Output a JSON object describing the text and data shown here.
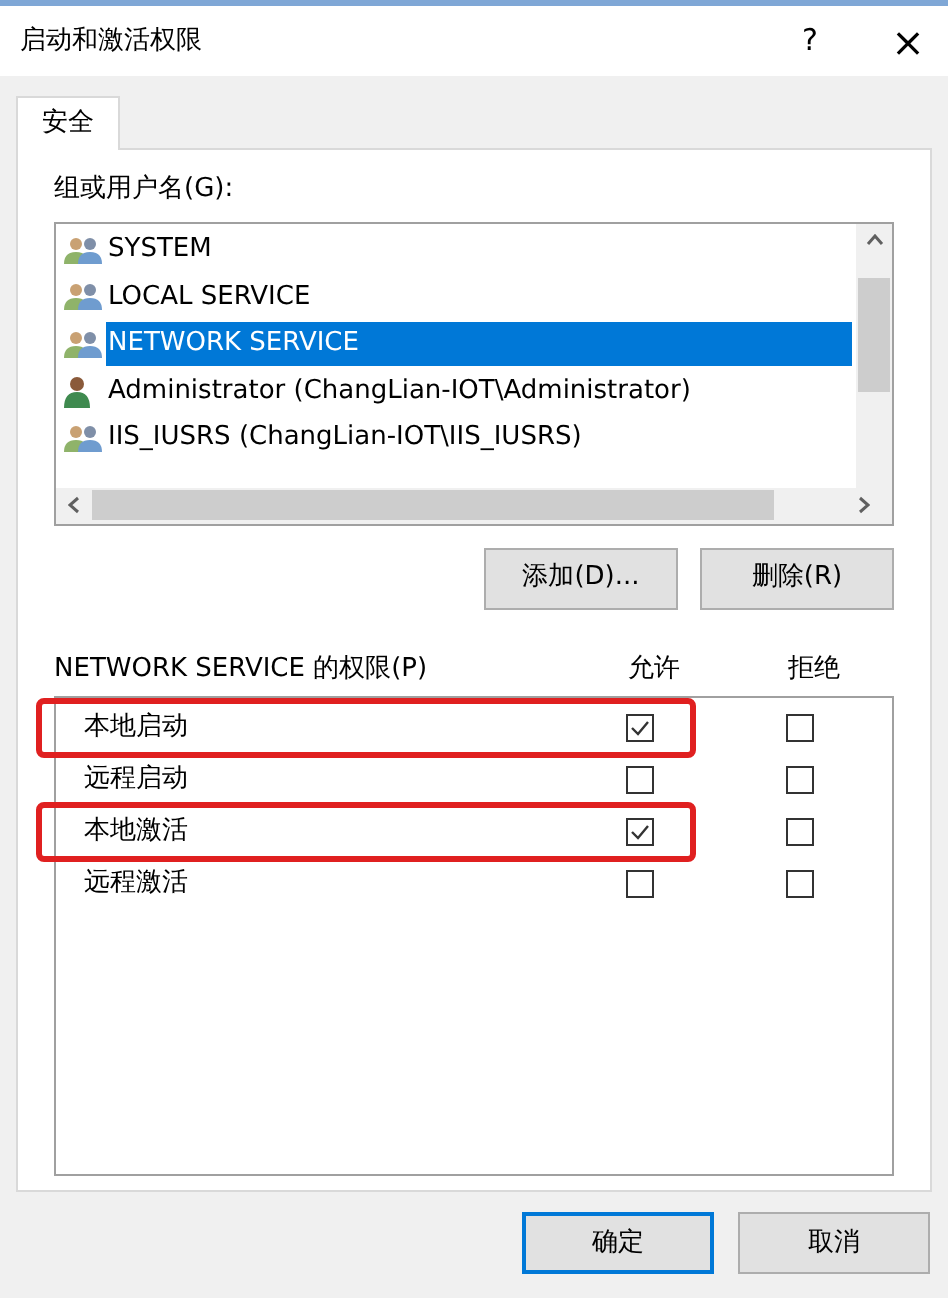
{
  "window": {
    "title": "启动和激活权限",
    "help": "?",
    "close": "×"
  },
  "tabs": [
    {
      "label": "安全",
      "selected": true
    }
  ],
  "users_label": "组或用户名(G):",
  "users": [
    {
      "name": "SYSTEM",
      "kind": "group",
      "selected": false
    },
    {
      "name": "LOCAL SERVICE",
      "kind": "group",
      "selected": false
    },
    {
      "name": "NETWORK SERVICE",
      "kind": "group",
      "selected": true
    },
    {
      "name": "Administrator (ChangLian-IOT\\Administrator)",
      "kind": "user",
      "selected": false
    },
    {
      "name": "IIS_IUSRS (ChangLian-IOT\\IIS_IUSRS)",
      "kind": "group",
      "selected": false
    }
  ],
  "user_buttons": [
    "添加(D)...",
    "删除(R)"
  ],
  "permissions_label": "NETWORK SERVICE 的权限(P)",
  "permission_columns": [
    "允许",
    "拒绝"
  ],
  "permissions": [
    {
      "name": "本地启动",
      "allow": true,
      "deny": false,
      "highlighted": true
    },
    {
      "name": "远程启动",
      "allow": false,
      "deny": false,
      "highlighted": false
    },
    {
      "name": "本地激活",
      "allow": true,
      "deny": false,
      "highlighted": true
    },
    {
      "name": "远程激活",
      "allow": false,
      "deny": false,
      "highlighted": false
    }
  ],
  "buttons": [
    {
      "label": "确定",
      "default": true
    },
    {
      "label": "取消",
      "default": false
    }
  ]
}
